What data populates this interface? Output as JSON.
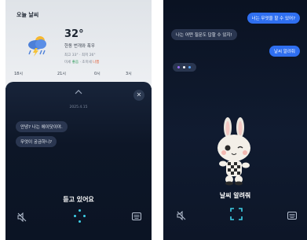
{
  "left": {
    "weather": {
      "title": "오늘 날씨",
      "temperature": "32°",
      "description": "한동 번개와 폭우",
      "hi_lo": "최고 33° · 최저 26°",
      "air_label": "미세",
      "air_good": "좋음",
      "air_mid": "· 초미세",
      "air_bad": "나쁨",
      "hours": [
        "18시",
        "21시",
        "0시",
        "3시"
      ],
      "icon": "thunderstorm-icon"
    },
    "sheet": {
      "date": "2025.4.15",
      "messages": [
        "안녕? 나는 에이닷이야.",
        "무엇이 궁금하니?"
      ],
      "status": "듣고 있어요"
    }
  },
  "right": {
    "messages": [
      {
        "from": "user",
        "text": "너는 무엇을 할 수 있어?"
      },
      {
        "from": "bot",
        "text": "나는 어떤 질문도 답할 수 있지!"
      },
      {
        "from": "user",
        "text": "날씨 알려줘"
      }
    ],
    "status": "날씨 알려줘",
    "typing_colors": [
      "#9b6bff",
      "#ffffff",
      "#5aa8ff"
    ]
  },
  "colors": {
    "accent": "#2f6ff0",
    "listening": "#3fd0e8"
  }
}
